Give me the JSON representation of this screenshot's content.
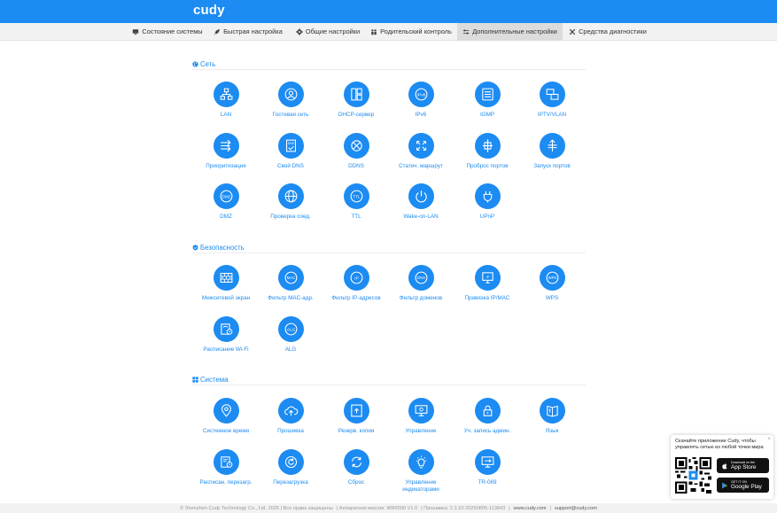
{
  "app": {
    "logo": "cudy"
  },
  "nav": {
    "tabs": [
      {
        "id": "status",
        "label": "Состояние системы",
        "icon": "monitor-icon"
      },
      {
        "id": "quick",
        "label": "Быстрая настройка",
        "icon": "rocket-icon"
      },
      {
        "id": "general",
        "label": "Общие настройки",
        "icon": "gear-icon"
      },
      {
        "id": "parental",
        "label": "Родительский контроль",
        "icon": "family-icon"
      },
      {
        "id": "advanced",
        "label": "Дополнительные настройки",
        "icon": "sliders-icon",
        "active": true
      },
      {
        "id": "diag",
        "label": "Средства диагностики",
        "icon": "tools-icon"
      }
    ]
  },
  "sections": {
    "network": {
      "title": "Сеть",
      "items": [
        {
          "label": "LAN",
          "icon": "lan-icon"
        },
        {
          "label": "Гостевая сеть",
          "icon": "guest-icon"
        },
        {
          "label": "DHCP-сервер",
          "icon": "dhcp-icon"
        },
        {
          "label": "IPv6",
          "icon": "ipv6-icon"
        },
        {
          "label": "IGMP",
          "icon": "igmp-icon"
        },
        {
          "label": "IPTV/VLAN",
          "icon": "iptv-icon"
        },
        {
          "label": "Приоритизация",
          "icon": "priority-icon"
        },
        {
          "label": "Свой DNS",
          "icon": "dns-icon"
        },
        {
          "label": "DDNS",
          "icon": "ddns-icon"
        },
        {
          "label": "Статич. маршрут",
          "icon": "route-icon"
        },
        {
          "label": "Проброс портов",
          "icon": "port-forward-icon"
        },
        {
          "label": "Запуск портов",
          "icon": "port-trigger-icon"
        },
        {
          "label": "DMZ",
          "icon": "dmz-icon"
        },
        {
          "label": "Проверка соед.",
          "icon": "connectivity-icon"
        },
        {
          "label": "TTL",
          "icon": "ttl-icon"
        },
        {
          "label": "Wake-on-LAN",
          "icon": "power-icon"
        },
        {
          "label": "UPnP",
          "icon": "plug-icon"
        }
      ]
    },
    "security": {
      "title": "Безопасность",
      "items": [
        {
          "label": "Межсетевой экран",
          "icon": "firewall-icon"
        },
        {
          "label": "Фильтр MAC-адр.",
          "icon": "mac-icon"
        },
        {
          "label": "Фильтр IP-адресов",
          "icon": "ip-icon"
        },
        {
          "label": "Фильтр доменов",
          "icon": "domain-icon"
        },
        {
          "label": "Привязка IP/MAC",
          "icon": "binding-icon"
        },
        {
          "label": "WPS",
          "icon": "wps-icon"
        },
        {
          "label": "Расписание Wi-Fi",
          "icon": "wifi-schedule-icon"
        },
        {
          "label": "ALG",
          "icon": "alg-icon"
        }
      ]
    },
    "system": {
      "title": "Система",
      "items": [
        {
          "label": "Системное время",
          "icon": "location-icon"
        },
        {
          "label": "Прошивка",
          "icon": "cloud-upload-icon"
        },
        {
          "label": "Резерв. копия",
          "icon": "backup-icon"
        },
        {
          "label": "Управление",
          "icon": "management-icon"
        },
        {
          "label": "Уч. запись админ.",
          "icon": "lock-icon"
        },
        {
          "label": "Язык",
          "icon": "language-icon"
        },
        {
          "label": "Расписан. перезагр.",
          "icon": "reboot-schedule-icon"
        },
        {
          "label": "Перезагрузка",
          "icon": "reboot-icon"
        },
        {
          "label": "Сброс",
          "icon": "reset-icon"
        },
        {
          "label": "Управление индикаторами",
          "icon": "led-icon"
        },
        {
          "label": "TR-069",
          "icon": "tr069-icon"
        }
      ]
    }
  },
  "footer": {
    "copyright": "© Shenzhen Cudy Technology Co., Ltd. 2025 | Все права защищены",
    "hw": "| Аппаратная версия: WR6500 V1.0",
    "fw": "| Прошивка: 2.3.10-20250805-113843",
    "site": "www.cudy.com",
    "email": "support@cudy.com"
  },
  "app_popup": {
    "text": "Скачайте приложение Cudy, чтобы управлять сетью из любой точки мира",
    "close": "×",
    "appstore_small": "Download on the",
    "appstore_big": "App Store",
    "gplay_small": "GET IT ON",
    "gplay_big": "Google Play"
  },
  "colors": {
    "accent": "#1c8bf2",
    "nav_bg": "#f2f2f2",
    "nav_active": "#dcdcdc"
  }
}
